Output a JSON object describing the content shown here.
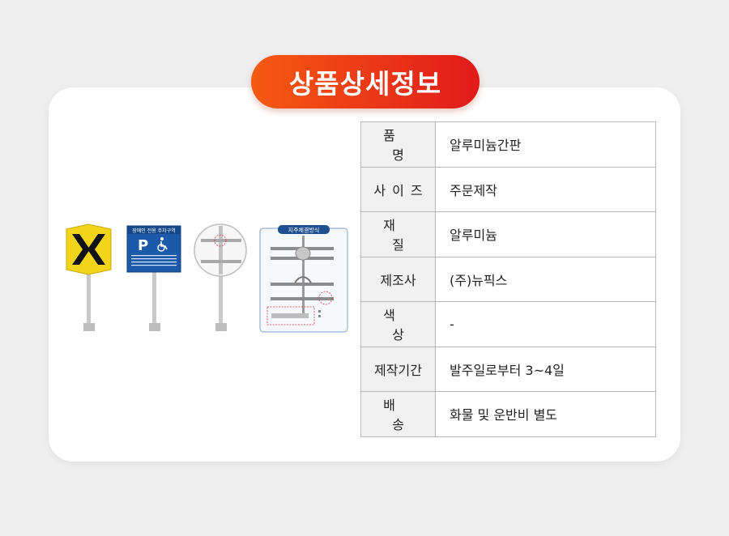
{
  "header": {
    "title": "상품상세정보"
  },
  "sign_panel": {
    "parking_sign_title": "장애인 전용 주차구역",
    "parking_letter": "P",
    "install_diagram_title": "지주체결방식"
  },
  "spec_rows": [
    {
      "key": "품 명",
      "value": "알루미늄간판"
    },
    {
      "key": "사이즈",
      "value": "주문제작"
    },
    {
      "key": "재 질",
      "value": "알루미늄"
    },
    {
      "key": "제조사",
      "value": "(주)뉴픽스"
    },
    {
      "key": "색 상",
      "value": "-"
    },
    {
      "key": "제작기간",
      "value": "발주일로부터 3~4일"
    },
    {
      "key": "배 송",
      "value": "화물 및 운반비 별도"
    }
  ],
  "colors": {
    "accent_start": "#f55a12",
    "accent_end": "#e11a1a",
    "parking_blue": "#1a5aa8",
    "chevron_yellow": "#f2d51a"
  }
}
